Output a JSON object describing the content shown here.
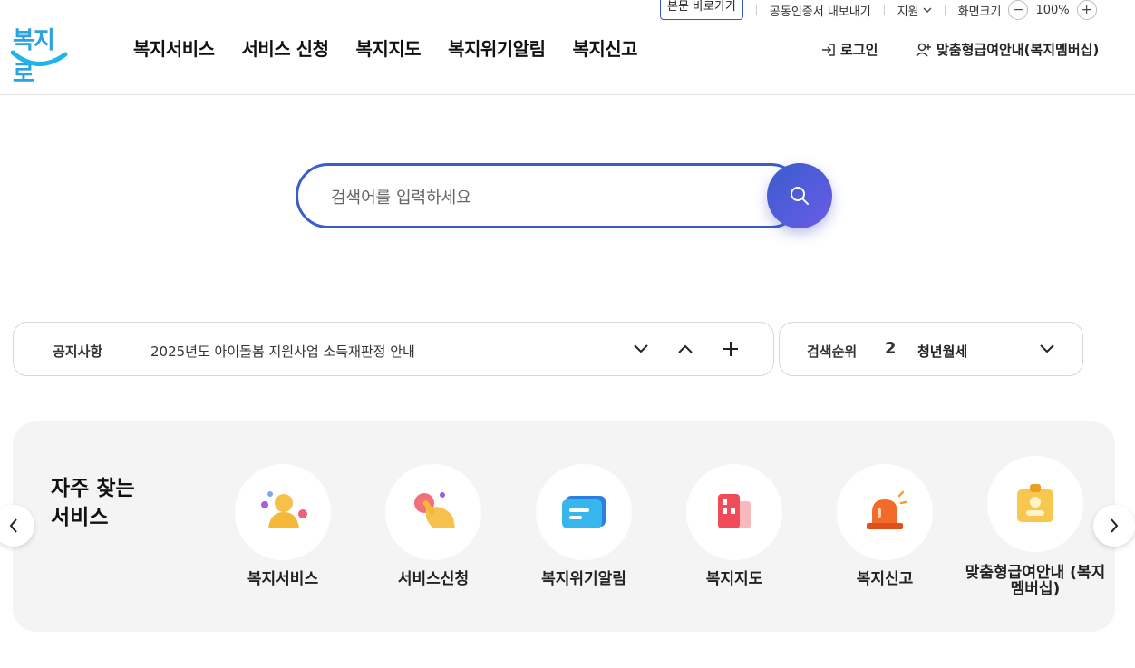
{
  "utility": {
    "skip_link": "본문 바로가기",
    "cert_export": "공동인증서 내보내기",
    "support": "지원",
    "screen_size": "화면크기",
    "zoom_level": "100%"
  },
  "header": {
    "logo_text": "복지로",
    "nav": [
      "복지서비스",
      "서비스 신청",
      "복지지도",
      "복지위기알림",
      "복지신고"
    ],
    "login": "로그인",
    "membership": "맞춤형급여안내(복지멤버십)"
  },
  "search": {
    "placeholder": "검색어를 입력하세요"
  },
  "notice": {
    "label": "공지사항",
    "text": "2025년도 아이돌봄 지원사업 소득재판정 안내"
  },
  "ranking": {
    "label": "검색순위",
    "rank": "2",
    "term": "청년월세"
  },
  "quick": {
    "title": "자주 찾는 서비스",
    "items": [
      {
        "label": "복지서비스",
        "icon": "person-icon"
      },
      {
        "label": "서비스신청",
        "icon": "hand-touch-icon"
      },
      {
        "label": "복지위기알림",
        "icon": "message-card-icon"
      },
      {
        "label": "복지지도",
        "icon": "building-icon"
      },
      {
        "label": "복지신고",
        "icon": "siren-icon"
      },
      {
        "label": "맞춤형급여안내 (복지멤버십)",
        "icon": "id-badge-icon"
      }
    ]
  },
  "colors": {
    "accent": "#3a5ccc",
    "logo": "#2aa3e0",
    "panel_bg": "#f4f4f4"
  }
}
